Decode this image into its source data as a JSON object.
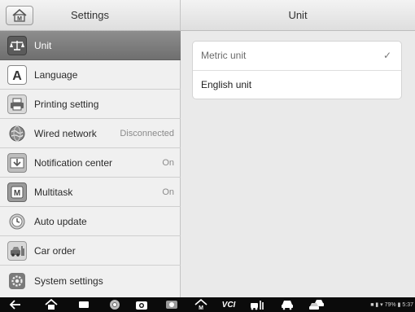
{
  "left_header": {
    "title": "Settings",
    "home_icon": "home-M-icon"
  },
  "right_header": {
    "title": "Unit"
  },
  "menu": [
    {
      "label": "Unit",
      "value": "",
      "icon": "scale-icon",
      "selected": true
    },
    {
      "label": "Language",
      "value": "",
      "icon": "letter-a-icon"
    },
    {
      "label": "Printing setting",
      "value": "",
      "icon": "printer-icon"
    },
    {
      "label": "Wired network",
      "value": "Disconnected",
      "icon": "network-globe-icon"
    },
    {
      "label": "Notification center",
      "value": "On",
      "icon": "notification-icon"
    },
    {
      "label": "Multitask",
      "value": "On",
      "icon": "multitask-M-icon"
    },
    {
      "label": "Auto update",
      "value": "",
      "icon": "update-clock-icon"
    },
    {
      "label": "Car order",
      "value": "",
      "icon": "car-order-icon"
    },
    {
      "label": "System settings",
      "value": "",
      "icon": "gear-icon"
    }
  ],
  "unit_options": [
    {
      "label": "Metric unit",
      "selected": true
    },
    {
      "label": "English unit",
      "selected": false
    }
  ],
  "bottom_bar": {
    "vci_label": "VCI",
    "status_text": "■ ▮ ▾ 79% ▮ 5:37"
  },
  "colors": {
    "selected_row": "#7e7e7e",
    "bottom_bar": "#0b0b0b",
    "pane_background": "#eaeaea"
  }
}
